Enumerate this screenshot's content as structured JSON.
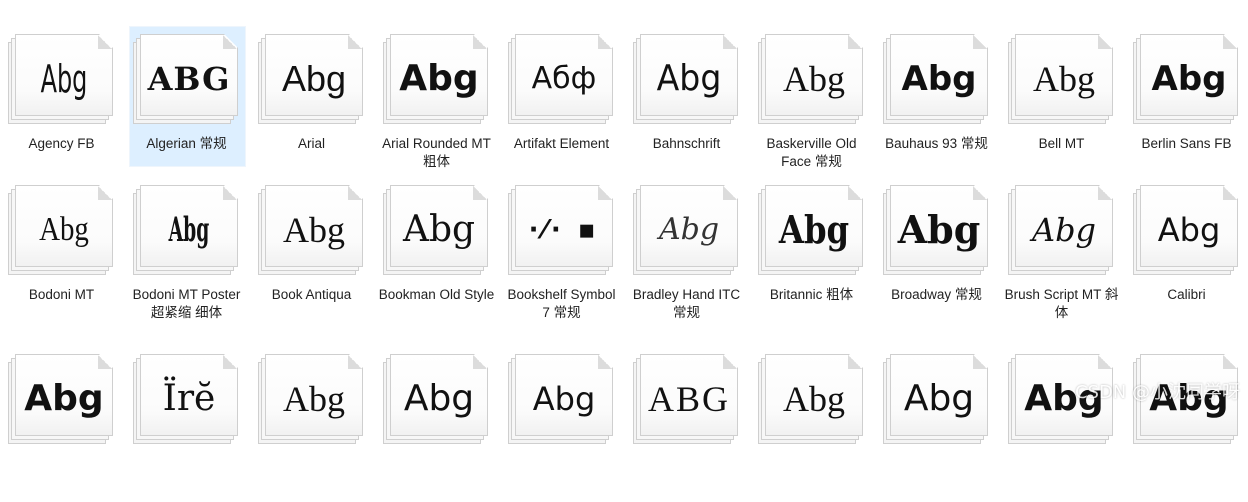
{
  "fonts": [
    {
      "label": "Agency FB",
      "sample": "Abg"
    },
    {
      "label": "Algerian 常规",
      "sample": "ABG"
    },
    {
      "label": "Arial",
      "sample": "Abg"
    },
    {
      "label": "Arial Rounded MT 粗体",
      "sample": "Abg"
    },
    {
      "label": "Artifakt Element",
      "sample": "Абф"
    },
    {
      "label": "Bahnschrift",
      "sample": "Abg"
    },
    {
      "label": "Baskerville Old Face 常规",
      "sample": "Abg"
    },
    {
      "label": "Bauhaus 93 常规",
      "sample": "Abg"
    },
    {
      "label": "Bell MT",
      "sample": "Abg"
    },
    {
      "label": "Berlin Sans FB",
      "sample": "Abg"
    },
    {
      "label": "Bodoni MT",
      "sample": "Abg"
    },
    {
      "label": "Bodoni MT Poster 超紧缩 细体",
      "sample": "Abg"
    },
    {
      "label": "Book Antiqua",
      "sample": "Abg"
    },
    {
      "label": "Bookman Old Style",
      "sample": "Abg"
    },
    {
      "label": "Bookshelf Symbol 7 常规",
      "sample": "·⁄·  ▪"
    },
    {
      "label": "Bradley Hand ITC 常规",
      "sample": "Abg"
    },
    {
      "label": "Britannic 粗体",
      "sample": "Abg"
    },
    {
      "label": "Broadway 常规",
      "sample": "Abg"
    },
    {
      "label": "Brush Script MT 斜体",
      "sample": "Abg"
    },
    {
      "label": "Calibri",
      "sample": "Abg"
    },
    {
      "label": "",
      "sample": "Abg"
    },
    {
      "label": "",
      "sample": "Ïrĕ"
    },
    {
      "label": "",
      "sample": "Abg"
    },
    {
      "label": "",
      "sample": "Abg"
    },
    {
      "label": "",
      "sample": "Abg"
    },
    {
      "label": "",
      "sample": "ABG"
    },
    {
      "label": "",
      "sample": "Abg"
    },
    {
      "label": "",
      "sample": "Abg"
    },
    {
      "label": "",
      "sample": "Abg"
    },
    {
      "label": "",
      "sample": "Abg"
    }
  ],
  "selected_index": 1,
  "watermark": "CSDN @小沈同学呀"
}
